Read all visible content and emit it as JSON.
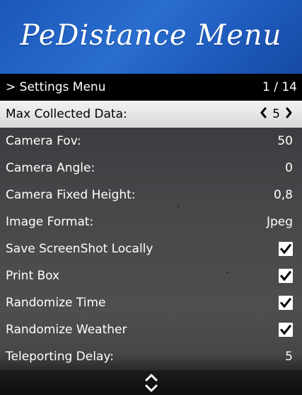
{
  "banner": {
    "title": "PeDistance Menu"
  },
  "subtitle": {
    "label": "> Settings Menu",
    "counter": "1 / 14"
  },
  "items": [
    {
      "label": "Max Collected Data:",
      "value": "5",
      "type": "selector"
    },
    {
      "label": "Camera Fov:",
      "value": "50",
      "type": "value"
    },
    {
      "label": "Camera Angle:",
      "value": "0",
      "type": "value"
    },
    {
      "label": "Camera Fixed Height:",
      "value": "0,8",
      "type": "value"
    },
    {
      "label": "Image Format:",
      "value": "Jpeg",
      "type": "value"
    },
    {
      "label": "Save ScreenShot Locally",
      "checked": true,
      "type": "checkbox"
    },
    {
      "label": "Print Box",
      "checked": true,
      "type": "checkbox"
    },
    {
      "label": "Randomize Time",
      "checked": true,
      "type": "checkbox"
    },
    {
      "label": "Randomize Weather",
      "checked": true,
      "type": "checkbox"
    },
    {
      "label": "Teleporting Delay:",
      "value": "5",
      "type": "value"
    }
  ],
  "icons": {
    "left": "chevron-left-icon",
    "right": "chevron-right-icon",
    "check": "checkmark-icon",
    "scroll": "up-down-arrows-icon"
  },
  "colors": {
    "banner": "#2a6ed0",
    "selected_bg": "#e6e6e6",
    "header_bg": "#000000"
  }
}
